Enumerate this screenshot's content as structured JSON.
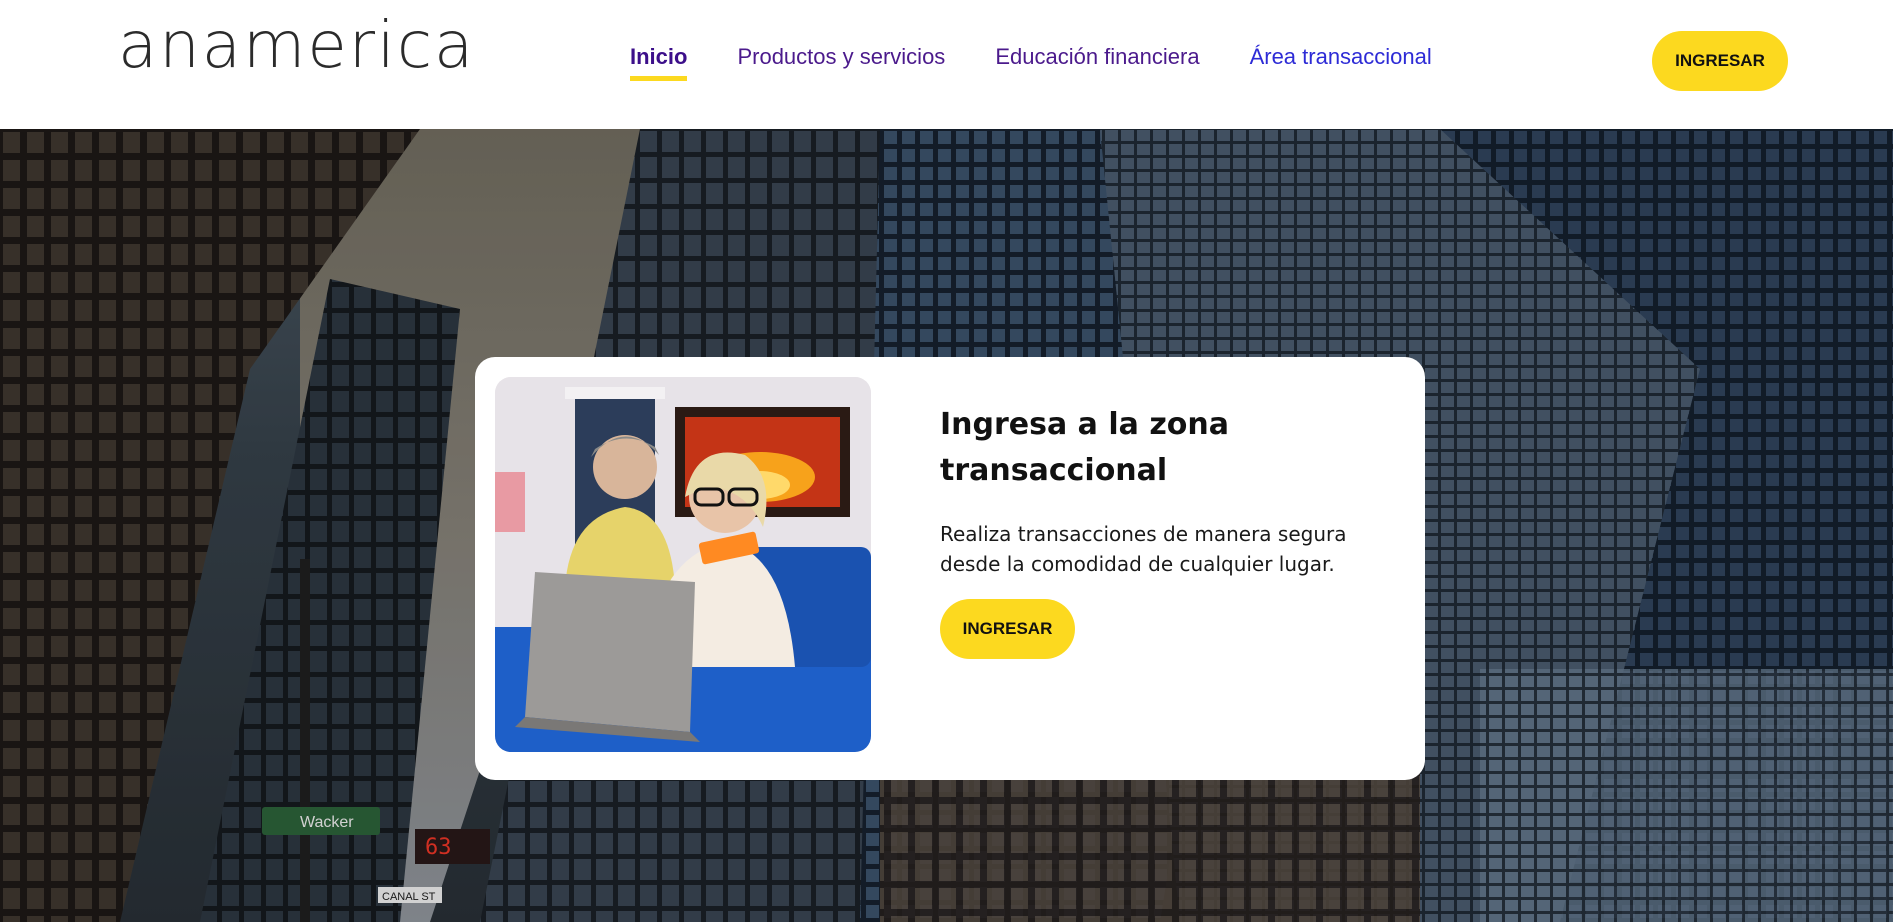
{
  "brand": {
    "logo_text": "anamerica"
  },
  "nav": {
    "items": [
      {
        "label": "Inicio"
      },
      {
        "label": "Productos y servicios"
      },
      {
        "label": "Educación financiera"
      },
      {
        "label": "Área transaccional"
      }
    ]
  },
  "header": {
    "login_label": "INGRESAR"
  },
  "hero": {
    "street_sign": "Wacker",
    "small_sign": "CANAL ST"
  },
  "card": {
    "title": "Ingresa a la zona transaccional",
    "description": "Realiza transacciones de manera segura desde la comodidad de cualquier lugar.",
    "button_label": "INGRESAR"
  },
  "colors": {
    "accent_yellow": "#fcd91f",
    "nav_purple": "#4b1a8c",
    "nav_blue": "#2d2bd6"
  }
}
